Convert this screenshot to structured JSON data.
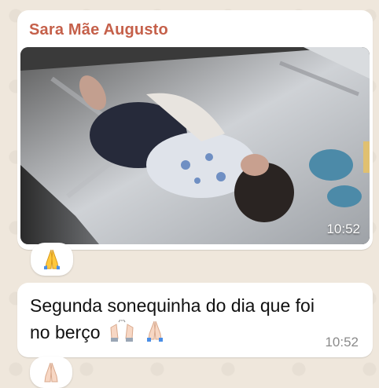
{
  "chat": {
    "sender_name": "Sara Mãe Augusto",
    "media_message": {
      "time": "10:52",
      "photo_icon": "sleeping-baby-in-crib-photo",
      "reaction_icon": "folded-hands-icon"
    },
    "text_message": {
      "text": "Segunda sonequinha do dia que foi no berço",
      "emoji_icons": [
        "raising-hands-icon",
        "folded-hands-icon"
      ],
      "time": "10:52",
      "reaction_icon": "folded-hands-icon"
    }
  },
  "colors": {
    "background": "#efe7dc",
    "bubble": "#ffffff",
    "sender_name": "#c5604a",
    "timestamp": "#8a8a8a",
    "reaction_skin_1": "#ffc83d",
    "reaction_skin_2": "#f7d7c4"
  }
}
